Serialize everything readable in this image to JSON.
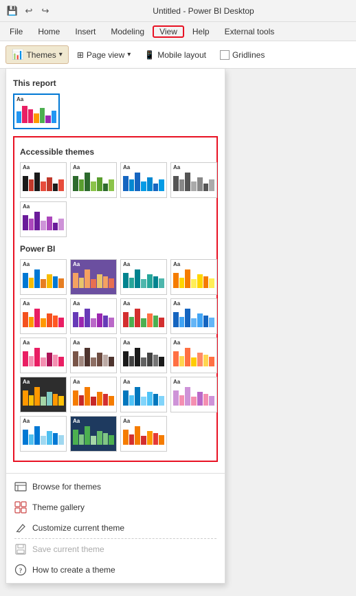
{
  "window": {
    "title": "Untitled - Power BI Desktop"
  },
  "titlebar": {
    "save_icon": "💾",
    "undo_icon": "↩",
    "redo_icon": "↪"
  },
  "menu": {
    "items": [
      "File",
      "Home",
      "Insert",
      "Modeling",
      "View",
      "Help",
      "External tools"
    ]
  },
  "ribbon": {
    "themes_label": "Themes",
    "page_view_label": "Page view",
    "mobile_layout_label": "Mobile layout",
    "gridlines_label": "Gridlines"
  },
  "panel": {
    "this_report_label": "This report",
    "accessible_themes_label": "Accessible themes",
    "power_bi_label": "Power BI",
    "bottom_items": [
      {
        "id": "browse",
        "label": "Browse for themes",
        "enabled": true
      },
      {
        "id": "gallery",
        "label": "Theme gallery",
        "enabled": true
      },
      {
        "id": "customize",
        "label": "Customize current theme",
        "enabled": true
      },
      {
        "id": "save",
        "label": "Save current theme",
        "enabled": false
      },
      {
        "id": "howto",
        "label": "How to create a theme",
        "enabled": true
      }
    ]
  }
}
